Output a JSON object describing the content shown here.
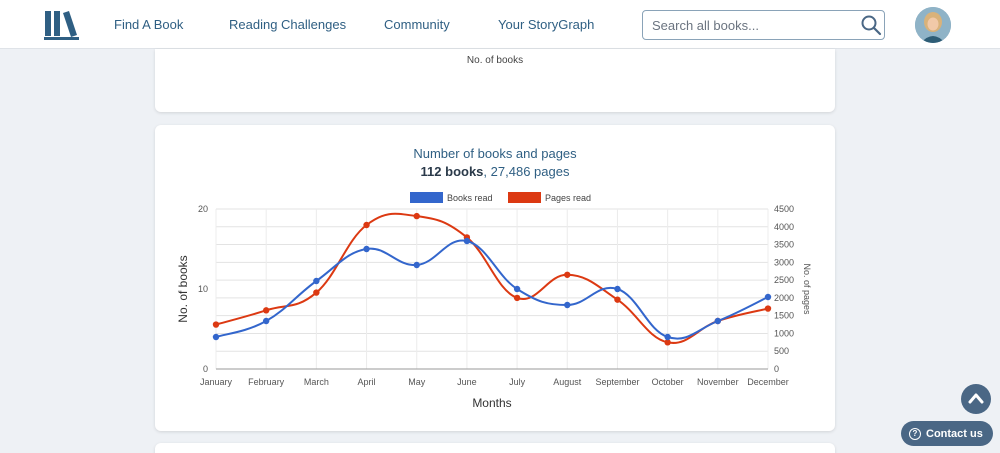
{
  "nav": {
    "links": [
      "Find A Book",
      "Reading Challenges",
      "Community",
      "Your StoryGraph"
    ],
    "search_placeholder": "Search all books..."
  },
  "top_card": {
    "axis_caption": "No. of books"
  },
  "main_card": {
    "title": "Number of books and pages",
    "books_total": "112 books",
    "pages_total": "27,486 pages",
    "separator": ", "
  },
  "chart_data": {
    "type": "line",
    "categories": [
      "January",
      "February",
      "March",
      "April",
      "May",
      "June",
      "July",
      "August",
      "September",
      "October",
      "November",
      "December"
    ],
    "series": [
      {
        "name": "Books read",
        "axis": "left",
        "color": "#3366cc",
        "values": [
          4,
          6,
          11,
          15,
          13,
          16,
          10,
          8,
          10,
          4,
          6,
          9
        ]
      },
      {
        "name": "Pages read",
        "axis": "right",
        "color": "#dc3912",
        "values": [
          1250,
          1650,
          2150,
          4050,
          4300,
          3700,
          2000,
          2650,
          1950,
          750,
          1350,
          1700
        ]
      }
    ],
    "xlabel": "Months",
    "ylabel": "No. of books",
    "y2label": "No. of pages",
    "ylim": [
      0,
      20
    ],
    "y2lim": [
      0,
      4500
    ],
    "yticks": [
      0,
      10,
      20
    ],
    "y2ticks": [
      0,
      500,
      1000,
      1500,
      2000,
      2500,
      3000,
      3500,
      4000,
      4500
    ],
    "grid": true,
    "legend": "top"
  },
  "widgets": {
    "contact_label": "Contact us"
  },
  "colors": {
    "brand": "#2f5f83",
    "button": "#4a6785"
  }
}
